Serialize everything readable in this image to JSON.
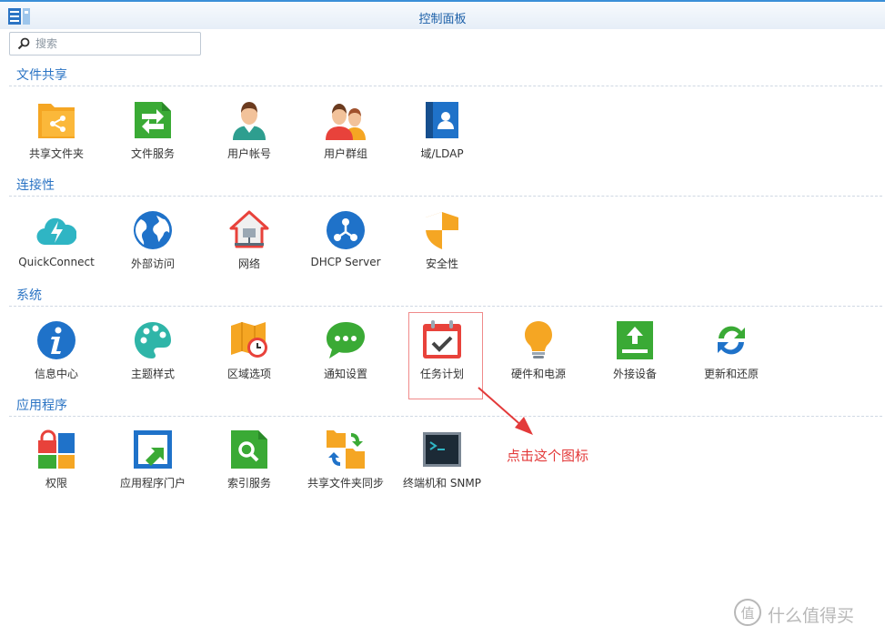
{
  "window": {
    "title": "控制面板"
  },
  "search": {
    "placeholder": "搜索"
  },
  "sections": [
    {
      "title": "文件共享",
      "items": [
        {
          "label": "共享文件夹",
          "icon": "shared-folder-icon"
        },
        {
          "label": "文件服务",
          "icon": "file-services-icon"
        },
        {
          "label": "用户帐号",
          "icon": "user-icon"
        },
        {
          "label": "用户群组",
          "icon": "group-icon"
        },
        {
          "label": "域/LDAP",
          "icon": "domain-ldap-icon"
        }
      ]
    },
    {
      "title": "连接性",
      "items": [
        {
          "label": "QuickConnect",
          "icon": "quickconnect-icon"
        },
        {
          "label": "外部访问",
          "icon": "globe-icon"
        },
        {
          "label": "网络",
          "icon": "network-house-icon"
        },
        {
          "label": "DHCP Server",
          "icon": "dhcp-icon"
        },
        {
          "label": "安全性",
          "icon": "shield-icon"
        }
      ]
    },
    {
      "title": "系统",
      "items": [
        {
          "label": "信息中心",
          "icon": "info-icon"
        },
        {
          "label": "主题样式",
          "icon": "palette-icon"
        },
        {
          "label": "区域选项",
          "icon": "map-clock-icon"
        },
        {
          "label": "通知设置",
          "icon": "chat-bubble-icon"
        },
        {
          "label": "任务计划",
          "icon": "calendar-check-icon"
        },
        {
          "label": "硬件和电源",
          "icon": "lightbulb-icon"
        },
        {
          "label": "外接设备",
          "icon": "external-device-icon"
        },
        {
          "label": "更新和还原",
          "icon": "refresh-icon"
        }
      ]
    },
    {
      "title": "应用程序",
      "items": [
        {
          "label": "权限",
          "icon": "lock-grid-icon"
        },
        {
          "label": "应用程序门户",
          "icon": "portal-icon"
        },
        {
          "label": "索引服务",
          "icon": "index-search-icon"
        },
        {
          "label": "共享文件夹同步",
          "icon": "folder-sync-icon"
        },
        {
          "label": "终端机和 SNMP",
          "icon": "terminal-icon"
        }
      ]
    }
  ],
  "annotation": {
    "text": "点击这个图标",
    "color": "#e33a3a"
  },
  "watermark": {
    "text": "什么值得买",
    "logo": "值"
  },
  "colors": {
    "accent": "#2b74c4",
    "highlight": "#f08a8a"
  }
}
